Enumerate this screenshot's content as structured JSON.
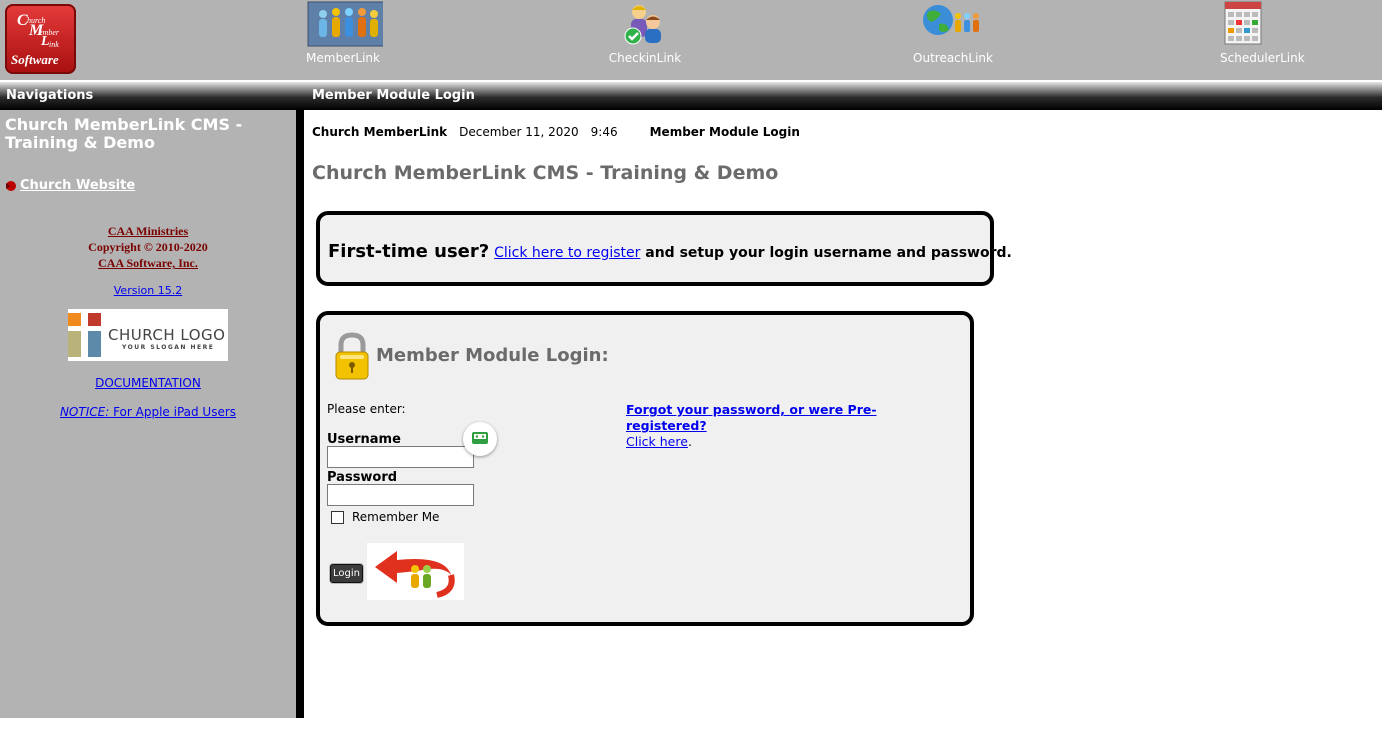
{
  "top_nav": {
    "logo_lines": [
      "C",
      "hurch",
      "M",
      "ember",
      "L",
      "ink",
      "Software"
    ],
    "modules": [
      {
        "label": "MemberLink",
        "icon": "member-link-icon"
      },
      {
        "label": "CheckinLink",
        "icon": "checkin-link-icon"
      },
      {
        "label": "OutreachLink",
        "icon": "outreach-link-icon"
      },
      {
        "label": "SchedulerLink",
        "icon": "scheduler-link-icon"
      }
    ]
  },
  "header": {
    "nav_label": "Navigations",
    "page_label": "Member Module Login"
  },
  "sidebar": {
    "title": "Church MemberLink CMS - Training & Demo",
    "church_website": "Church Website",
    "ministries": "CAA Ministries",
    "copyright": "Copyright © 2010-2020",
    "company": "CAA Software, Inc.",
    "version": "Version 15.2",
    "church_logo_text": "CHURCH LOGO",
    "church_logo_slogan": "YOUR SLOGAN HERE",
    "documentation": "DOCUMENTATION",
    "notice_prefix": "NOTICE:",
    "notice_text": " For Apple iPad Users"
  },
  "main": {
    "app_name": "Church MemberLink",
    "date": "December 11, 2020",
    "time": "9:46",
    "module_name": "Member Module Login",
    "page_title": "Church MemberLink CMS - Training & Demo",
    "register": {
      "lead": "First-time user?",
      "link": "Click here to register",
      "rest": " and setup your login username and password."
    },
    "login": {
      "heading": "Member Module Login:",
      "please_enter": "Please enter:",
      "username_label": "Username",
      "username_value": "",
      "password_label": "Password",
      "password_value": "",
      "remember_me": "Remember Me",
      "login_button": "Login",
      "forgot_link": "Forgot your password, or were Pre-registered?",
      "click_here": "Click here",
      "click_here_suffix": "."
    }
  },
  "colors": {
    "gray_bg": "#b3b3b3",
    "link_blue": "#0000ee",
    "copyright_red": "#7a0000",
    "title_gray": "#6b6b6b"
  }
}
